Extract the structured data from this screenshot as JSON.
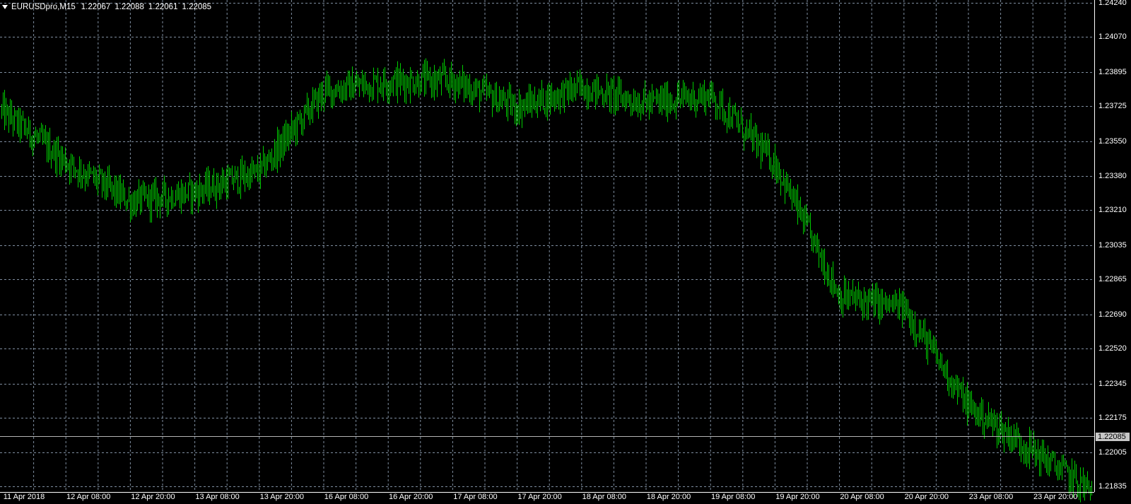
{
  "header": {
    "symbol": "EURUSDpro,M15",
    "open": "1.22067",
    "high": "1.22088",
    "low": "1.22061",
    "close": "1.22085"
  },
  "price_axis": {
    "labels": [
      "1.24240",
      "1.24070",
      "1.23895",
      "1.23725",
      "1.23550",
      "1.23380",
      "1.23210",
      "1.23035",
      "1.22865",
      "1.22690",
      "1.22520",
      "1.22345",
      "1.22175",
      "1.22005",
      "1.21835"
    ],
    "current_price": "1.22085"
  },
  "time_axis": {
    "labels": [
      "11 Apr 2018",
      "12 Apr 08:00",
      "12 Apr 20:00",
      "13 Apr 08:00",
      "13 Apr 20:00",
      "16 Apr 08:00",
      "16 Apr 20:00",
      "17 Apr 08:00",
      "17 Apr 20:00",
      "18 Apr 08:00",
      "18 Apr 20:00",
      "19 Apr 08:00",
      "19 Apr 20:00",
      "20 Apr 08:00",
      "20 Apr 20:00",
      "23 Apr 08:00",
      "23 Apr 20:00"
    ]
  },
  "colors": {
    "background": "#000000",
    "bars": "#00cc00",
    "grid": "#7f8ea0",
    "axis_text": "#ffffff",
    "current_line": "#b4b4b4"
  },
  "chart_data": {
    "type": "line",
    "symbol": "EURUSDpro",
    "timeframe": "M15",
    "x": [
      "11 Apr 2018",
      "12 Apr 08:00",
      "12 Apr 20:00",
      "13 Apr 08:00",
      "13 Apr 20:00",
      "16 Apr 08:00",
      "16 Apr 20:00",
      "17 Apr 08:00",
      "17 Apr 20:00",
      "18 Apr 08:00",
      "18 Apr 20:00",
      "19 Apr 08:00",
      "19 Apr 20:00",
      "20 Apr 08:00",
      "20 Apr 20:00",
      "23 Apr 08:00",
      "23 Apr 20:00"
    ],
    "series": [
      {
        "values": [
          1.237,
          1.2345,
          1.2325,
          1.233,
          1.234,
          1.238,
          1.2385,
          1.2385,
          1.2372,
          1.2382,
          1.2374,
          1.2378,
          1.2344,
          1.2278,
          1.2272,
          1.2223,
          1.2201
        ]
      }
    ],
    "ylim": [
      1.21835,
      1.2424
    ],
    "grid": true
  }
}
